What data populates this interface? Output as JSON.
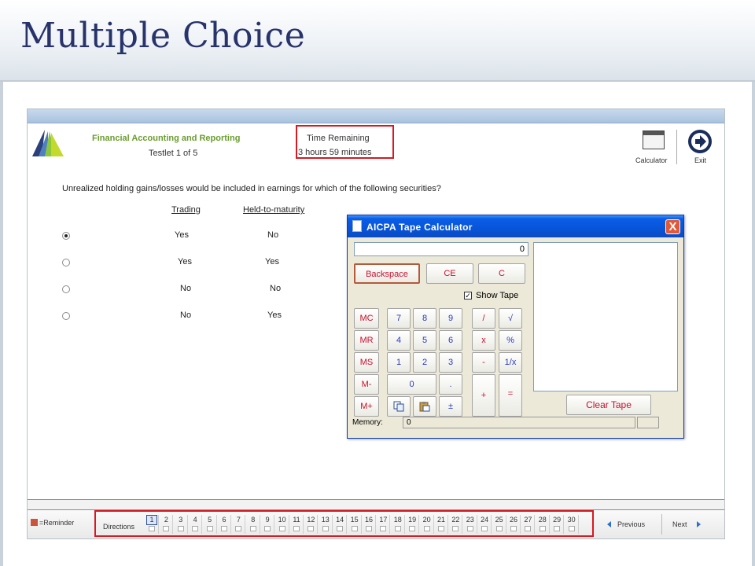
{
  "slide": {
    "title": "Multiple Choice"
  },
  "header": {
    "section": "Financial Accounting and Reporting",
    "testlet": "Testlet 1 of 5",
    "timer_label": "Time Remaining",
    "timer_value": "3 hours 59 minutes",
    "calculator_label": "Calculator",
    "exit_label": "Exit"
  },
  "question": {
    "text": "Unrealized holding gains/losses would be included in earnings for which of the following securities?",
    "columns": [
      "Trading",
      "Held-to-maturity"
    ],
    "options": [
      {
        "a": "Yes",
        "b": "No",
        "selected": true
      },
      {
        "a": "Yes",
        "b": "Yes",
        "selected": false
      },
      {
        "a": "No",
        "b": "No",
        "selected": false
      },
      {
        "a": "No",
        "b": "Yes",
        "selected": false
      }
    ]
  },
  "calculator": {
    "title": "AICPA Tape Calculator",
    "close": "X",
    "display": "0",
    "backspace": "Backspace",
    "ce": "CE",
    "c": "C",
    "show_tape": "Show Tape",
    "show_tape_checked": "✓",
    "clear_tape": "Clear Tape",
    "memory_label": "Memory:",
    "memory_value": "0",
    "keys": {
      "mc": "MC",
      "mr": "MR",
      "ms": "MS",
      "mminus": "M-",
      "mplus": "M+",
      "k7": "7",
      "k8": "8",
      "k9": "9",
      "k4": "4",
      "k5": "5",
      "k6": "6",
      "k1": "1",
      "k2": "2",
      "k3": "3",
      "k0": "0",
      "dot": ".",
      "pm": "±",
      "div": "/",
      "sqrt": "√",
      "mul": "x",
      "pct": "%",
      "sub": "-",
      "inv": "1/x",
      "add": "+",
      "eq": "="
    }
  },
  "footer": {
    "reminder": "=Reminder",
    "directions": "Directions",
    "questions": [
      "1",
      "2",
      "3",
      "4",
      "5",
      "6",
      "7",
      "8",
      "9",
      "10",
      "11",
      "12",
      "13",
      "14",
      "15",
      "16",
      "17",
      "18",
      "19",
      "20",
      "21",
      "22",
      "23",
      "24",
      "25",
      "26",
      "27",
      "28",
      "29",
      "30"
    ],
    "current": "1",
    "previous": "Previous",
    "next": "Next"
  }
}
